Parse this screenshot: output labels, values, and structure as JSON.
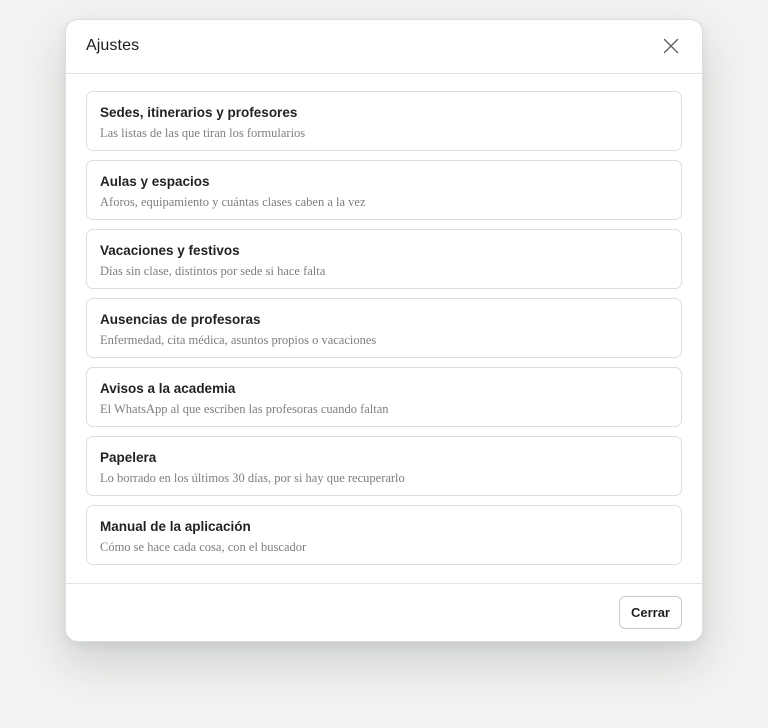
{
  "modal": {
    "title": "Ajustes",
    "close_icon": "close-icon",
    "items": [
      {
        "title": "Sedes, itinerarios y profesores",
        "description": "Las listas de las que tiran los formularios"
      },
      {
        "title": "Aulas y espacios",
        "description": "Aforos, equipamiento y cuántas clases caben a la vez"
      },
      {
        "title": "Vacaciones y festivos",
        "description": "Días sin clase, distintos por sede si hace falta"
      },
      {
        "title": "Ausencias de profesoras",
        "description": "Enfermedad, cita médica, asuntos propios o vacaciones"
      },
      {
        "title": "Avisos a la academia",
        "description": "El WhatsApp al que escriben las profesoras cuando faltan"
      },
      {
        "title": "Papelera",
        "description": "Lo borrado en los últimos 30 días, por si hay que recuperarlo"
      },
      {
        "title": "Manual de la aplicación",
        "description": "Cómo se hace cada cosa, con el buscador"
      }
    ],
    "footer": {
      "close_label": "Cerrar"
    }
  },
  "colors": {
    "background": "#f2f3f1",
    "surface": "#ffffff",
    "border": "#dcdedd",
    "text_primary": "#1f2224",
    "text_secondary": "#7b7f81"
  }
}
